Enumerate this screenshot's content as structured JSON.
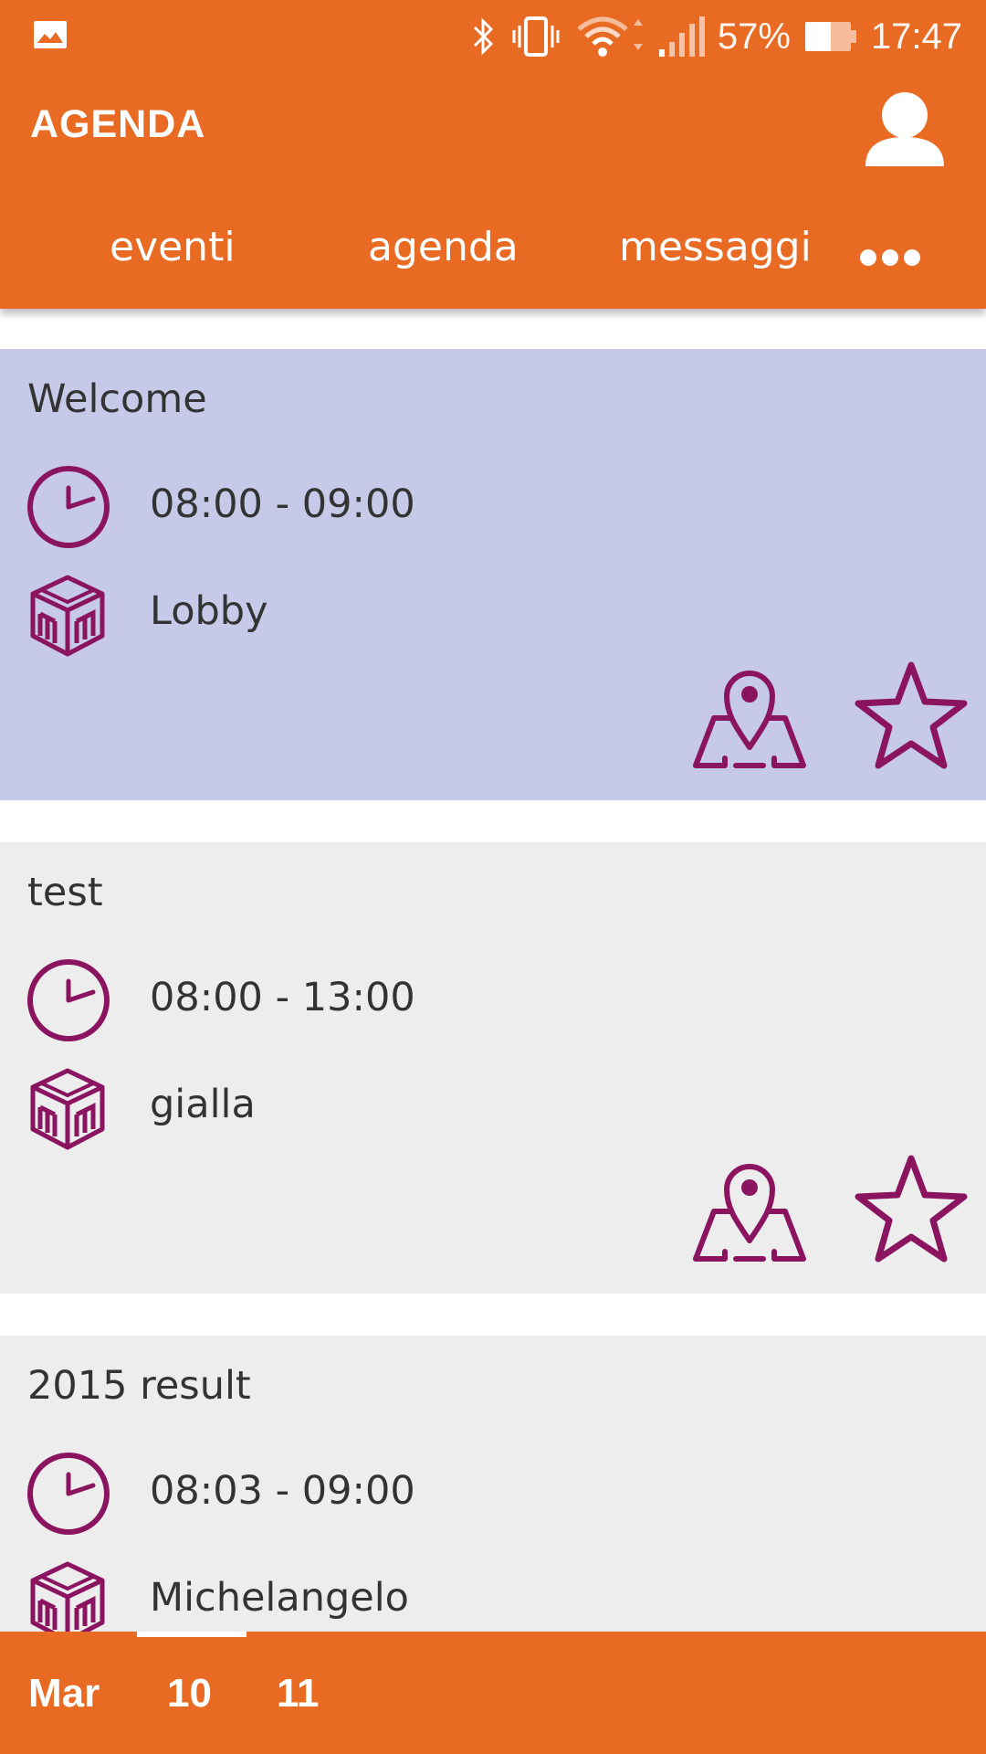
{
  "status_bar": {
    "battery": "57%",
    "time": "17:47",
    "icons": [
      "gallery-icon",
      "bluetooth-icon",
      "vibrate-icon",
      "wifi-icon",
      "signal-icon",
      "battery-icon"
    ]
  },
  "header": {
    "title": "AGENDA",
    "profile_icon": "user-icon"
  },
  "nav": {
    "tabs": [
      {
        "label": "eventi"
      },
      {
        "label": "agenda"
      },
      {
        "label": "messaggi"
      }
    ],
    "more_icon": "more-dots-icon"
  },
  "colors": {
    "accent": "#E96A22",
    "icon": "#8B1460",
    "highlight_card": "#C7C9E8",
    "card": "#EDEDED",
    "text": "#333333"
  },
  "events": [
    {
      "title": "Welcome",
      "time": "08:00 - 09:00",
      "room": "Lobby",
      "highlighted": true
    },
    {
      "title": "test",
      "time": "08:00 - 13:00",
      "room": "gialla",
      "highlighted": false
    },
    {
      "title": "2015 result",
      "time": "08:03 - 09:00",
      "room": "Michelangelo",
      "highlighted": false
    }
  ],
  "date_bar": {
    "month": "Mar",
    "days": [
      "10",
      "11"
    ],
    "selected": "10"
  }
}
